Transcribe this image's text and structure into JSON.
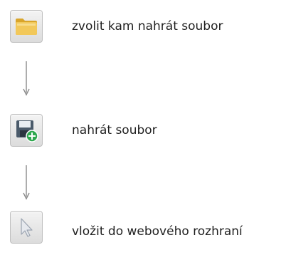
{
  "steps": [
    {
      "label": "zvolit kam nahrát soubor",
      "icon": "folder-icon"
    },
    {
      "label": "nahrát soubor",
      "icon": "save-add-icon"
    },
    {
      "label": "vložit do webového rozhraní",
      "icon": "cursor-arrow-icon"
    }
  ],
  "colors": {
    "folder": "#f2c85a",
    "folder_dark": "#d9a52b",
    "disk": "#4a5a6a",
    "plus_green": "#2fa84f",
    "arrow": "#8a8a8a",
    "cursor": "#bfc6d2"
  }
}
